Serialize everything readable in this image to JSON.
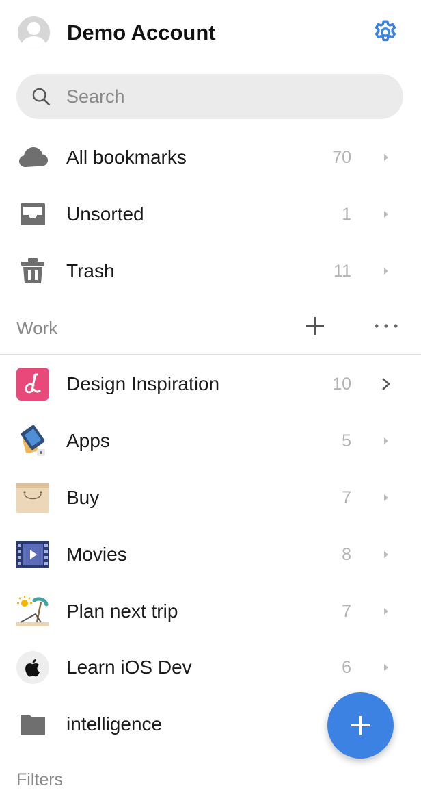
{
  "header": {
    "account_name": "Demo Account"
  },
  "search": {
    "placeholder": "Search"
  },
  "system": [
    {
      "label": "All bookmarks",
      "count": "70",
      "icon": "cloud-icon"
    },
    {
      "label": "Unsorted",
      "count": "1",
      "icon": "inbox-icon"
    },
    {
      "label": "Trash",
      "count": "11",
      "icon": "trash-icon"
    }
  ],
  "section": {
    "label": "Work"
  },
  "collections": [
    {
      "label": "Design Inspiration",
      "count": "10",
      "icon": "design-inspiration-icon"
    },
    {
      "label": "Apps",
      "count": "5",
      "icon": "apps-icon"
    },
    {
      "label": "Buy",
      "count": "7",
      "icon": "shopping-bag-icon"
    },
    {
      "label": "Movies",
      "count": "8",
      "icon": "film-icon"
    },
    {
      "label": "Plan next trip",
      "count": "7",
      "icon": "beach-icon"
    },
    {
      "label": "Learn iOS Dev",
      "count": "6",
      "icon": "apple-icon"
    },
    {
      "label": "intelligence",
      "count": "",
      "icon": "folder-icon"
    }
  ],
  "filters": {
    "label": "Filters"
  },
  "colors": {
    "accent": "#3b82e3",
    "muted": "#8a8a8a"
  }
}
